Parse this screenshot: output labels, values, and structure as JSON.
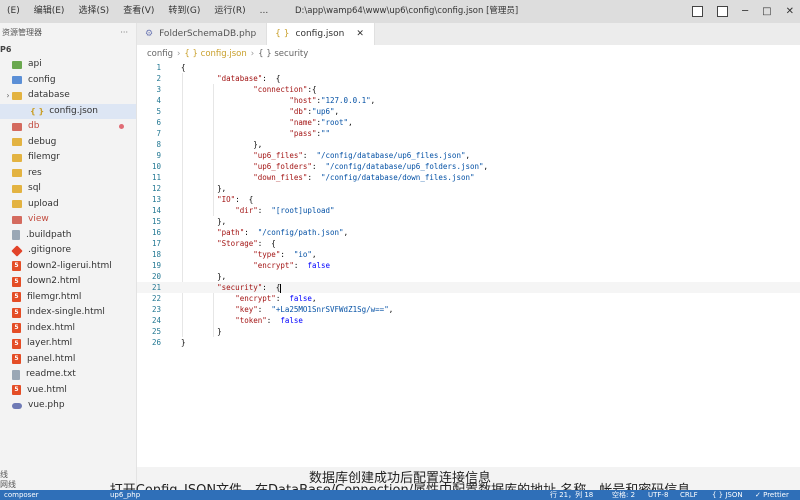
{
  "menu": [
    "(E)",
    "编辑(E)",
    "选择(S)",
    "查看(V)",
    "转到(G)",
    "运行(R)",
    "..."
  ],
  "window_title": "D:\\app\\wamp64\\www\\up6\\config\\config.json [管理员]",
  "sidebar": {
    "header": "资源管理器",
    "header_more": "···",
    "project": "P6",
    "items": [
      {
        "label": "api",
        "icon": "folder-green",
        "indent": 1
      },
      {
        "label": "config",
        "icon": "folder-blue",
        "indent": 1
      },
      {
        "label": "database",
        "icon": "folder",
        "indent": 1,
        "chevron": "›"
      },
      {
        "label": "config.json",
        "icon": "json",
        "indent": 2,
        "selected": true
      },
      {
        "label": "db",
        "icon": "folder-red",
        "indent": 1,
        "modified": true
      },
      {
        "label": "debug",
        "icon": "folder",
        "indent": 1
      },
      {
        "label": "filemgr",
        "icon": "folder",
        "indent": 1
      },
      {
        "label": "res",
        "icon": "folder",
        "indent": 1
      },
      {
        "label": "sql",
        "icon": "folder",
        "indent": 1
      },
      {
        "label": "upload",
        "icon": "folder",
        "indent": 1
      },
      {
        "label": "view",
        "icon": "folder-red",
        "indent": 1
      },
      {
        "label": ".buildpath",
        "icon": "txt",
        "indent": 1
      },
      {
        "label": ".gitignore",
        "icon": "git",
        "indent": 1
      },
      {
        "label": "down2-ligerui.html",
        "icon": "html",
        "indent": 1
      },
      {
        "label": "down2.html",
        "icon": "html",
        "indent": 1
      },
      {
        "label": "filemgr.html",
        "icon": "html",
        "indent": 1
      },
      {
        "label": "index-single.html",
        "icon": "html",
        "indent": 1
      },
      {
        "label": "index.html",
        "icon": "html",
        "indent": 1
      },
      {
        "label": "layer.html",
        "icon": "html",
        "indent": 1
      },
      {
        "label": "panel.html",
        "icon": "html",
        "indent": 1
      },
      {
        "label": "readme.txt",
        "icon": "txt",
        "indent": 1
      },
      {
        "label": "vue.html",
        "icon": "html",
        "indent": 1
      },
      {
        "label": "vue.php",
        "icon": "php",
        "indent": 1
      }
    ],
    "bottom_label": "线",
    "outline_label": "网线"
  },
  "tabs": [
    {
      "label": "FolderSchemaDB.php",
      "icon": "⚙",
      "active": false
    },
    {
      "label": "config.json",
      "icon": "{ }",
      "active": true,
      "close": "✕"
    }
  ],
  "breadcrumb": [
    "config",
    "{ } config.json",
    "{ } security"
  ],
  "code_lines": [
    [
      [
        "p",
        "{"
      ]
    ],
    [
      [
        "p",
        "        "
      ],
      [
        "k",
        "\"database\""
      ],
      [
        "p",
        ":  {"
      ]
    ],
    [
      [
        "p",
        "                "
      ],
      [
        "k",
        "\"connection\""
      ],
      [
        "p",
        ":{"
      ]
    ],
    [
      [
        "p",
        "                        "
      ],
      [
        "k",
        "\"host\""
      ],
      [
        "p",
        ":"
      ],
      [
        "s",
        "\"127.0.0.1\""
      ],
      [
        "p",
        ","
      ]
    ],
    [
      [
        "p",
        "                        "
      ],
      [
        "k",
        "\"db\""
      ],
      [
        "p",
        ":"
      ],
      [
        "s",
        "\"up6\""
      ],
      [
        "p",
        ","
      ]
    ],
    [
      [
        "p",
        "                        "
      ],
      [
        "k",
        "\"name\""
      ],
      [
        "p",
        ":"
      ],
      [
        "s",
        "\"root\""
      ],
      [
        "p",
        ","
      ]
    ],
    [
      [
        "p",
        "                        "
      ],
      [
        "k",
        "\"pass\""
      ],
      [
        "p",
        ":"
      ],
      [
        "s",
        "\"\""
      ]
    ],
    [
      [
        "p",
        "                },"
      ]
    ],
    [
      [
        "p",
        "                "
      ],
      [
        "k",
        "\"up6_files\""
      ],
      [
        "p",
        ":  "
      ],
      [
        "s",
        "\"/config/database/up6_files.json\""
      ],
      [
        "p",
        ","
      ]
    ],
    [
      [
        "p",
        "                "
      ],
      [
        "k",
        "\"up6_folders\""
      ],
      [
        "p",
        ":  "
      ],
      [
        "s",
        "\"/config/database/up6_folders.json\""
      ],
      [
        "p",
        ","
      ]
    ],
    [
      [
        "p",
        "                "
      ],
      [
        "k",
        "\"down_files\""
      ],
      [
        "p",
        ":  "
      ],
      [
        "s",
        "\"/config/database/down_files.json\""
      ]
    ],
    [
      [
        "p",
        "        },"
      ]
    ],
    [
      [
        "p",
        "        "
      ],
      [
        "k",
        "\"IO\""
      ],
      [
        "p",
        ":  {"
      ]
    ],
    [
      [
        "p",
        "            "
      ],
      [
        "k",
        "\"dir\""
      ],
      [
        "p",
        ":  "
      ],
      [
        "s",
        "\"[root]upload\""
      ]
    ],
    [
      [
        "p",
        "        },"
      ]
    ],
    [
      [
        "p",
        "        "
      ],
      [
        "k",
        "\"path\""
      ],
      [
        "p",
        ":  "
      ],
      [
        "s",
        "\"/config/path.json\""
      ],
      [
        "p",
        ","
      ]
    ],
    [
      [
        "p",
        "        "
      ],
      [
        "k",
        "\"Storage\""
      ],
      [
        "p",
        ":  {"
      ]
    ],
    [
      [
        "p",
        "                "
      ],
      [
        "k",
        "\"type\""
      ],
      [
        "p",
        ":  "
      ],
      [
        "s",
        "\"io\""
      ],
      [
        "p",
        ","
      ]
    ],
    [
      [
        "p",
        "                "
      ],
      [
        "k",
        "\"encrypt\""
      ],
      [
        "p",
        ":  "
      ],
      [
        "b",
        "false"
      ]
    ],
    [
      [
        "p",
        "        },"
      ]
    ],
    [
      [
        "p",
        "        "
      ],
      [
        "k",
        "\"security\""
      ],
      [
        "p",
        ":  {"
      ],
      [
        "cursor",
        ""
      ]
    ],
    [
      [
        "p",
        "            "
      ],
      [
        "k",
        "\"encrypt\""
      ],
      [
        "p",
        ":  "
      ],
      [
        "b",
        "false"
      ],
      [
        "p",
        ","
      ]
    ],
    [
      [
        "p",
        "            "
      ],
      [
        "k",
        "\"key\""
      ],
      [
        "p",
        ":  "
      ],
      [
        "s",
        "\"+La25MO1SnrSVFWdZ1Sg/w==\""
      ],
      [
        "p",
        ","
      ]
    ],
    [
      [
        "p",
        "            "
      ],
      [
        "k",
        "\"token\""
      ],
      [
        "p",
        ":  "
      ],
      [
        "b",
        "false"
      ]
    ],
    [
      [
        "p",
        "        }"
      ]
    ],
    [
      [
        "p",
        "}"
      ]
    ]
  ],
  "subtitle_line1": "数据库创建成功后配置连接信息",
  "subtitle_line2": "打开Config_JSON文件，在DataBase/Connection/属性中配置数据库的地址 名称、帐号和密码信息",
  "statusbar": {
    "left": "composer",
    "file": "up6_php",
    "position": "行 21，列 18",
    "spaces": "空格: 2",
    "encoding": "UTF-8",
    "eol": "CRLF",
    "language": "{ } JSON",
    "formatter": "✓ Prettier"
  },
  "colors": {
    "accent": "#2f6fb8",
    "string": "#0451a5",
    "key": "#a31515",
    "keyword": "#0000ff"
  }
}
